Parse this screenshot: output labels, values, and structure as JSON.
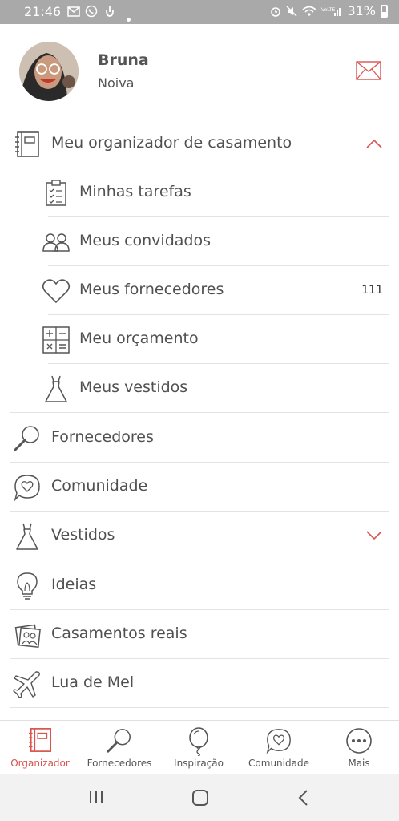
{
  "status_bar": {
    "time": "21:46",
    "battery": "31%"
  },
  "profile": {
    "name": "Bruna",
    "role": "Noiva"
  },
  "colors": {
    "accent": "#d9534f",
    "icon": "#555555",
    "divider": "#e3e3e3"
  },
  "menu": {
    "organizer": {
      "label": "Meu organizador de casamento",
      "icon": "planner-icon",
      "expanded": true
    },
    "organizer_items": [
      {
        "label": "Minhas tarefas",
        "icon": "checklist-icon"
      },
      {
        "label": "Meus convidados",
        "icon": "guests-icon"
      },
      {
        "label": "Meus fornecedores",
        "icon": "heart-icon",
        "badge": "111"
      },
      {
        "label": "Meu orçamento",
        "icon": "calculator-icon"
      },
      {
        "label": "Meus vestidos",
        "icon": "dress-icon"
      }
    ],
    "items": [
      {
        "label": "Fornecedores",
        "icon": "search-icon"
      },
      {
        "label": "Comunidade",
        "icon": "chat-heart-icon"
      },
      {
        "label": "Vestidos",
        "icon": "dress-icon",
        "expandable": true
      },
      {
        "label": "Ideias",
        "icon": "lightbulb-icon"
      },
      {
        "label": "Casamentos reais",
        "icon": "photos-icon"
      },
      {
        "label": "Lua de Mel",
        "icon": "airplane-icon"
      }
    ]
  },
  "bottom_nav": [
    {
      "label": "Organizador",
      "icon": "planner-icon",
      "active": true
    },
    {
      "label": "Fornecedores",
      "icon": "search-icon"
    },
    {
      "label": "Inspiração",
      "icon": "balloon-icon"
    },
    {
      "label": "Comunidade",
      "icon": "chat-heart-icon"
    },
    {
      "label": "Mais",
      "icon": "more-icon"
    }
  ]
}
